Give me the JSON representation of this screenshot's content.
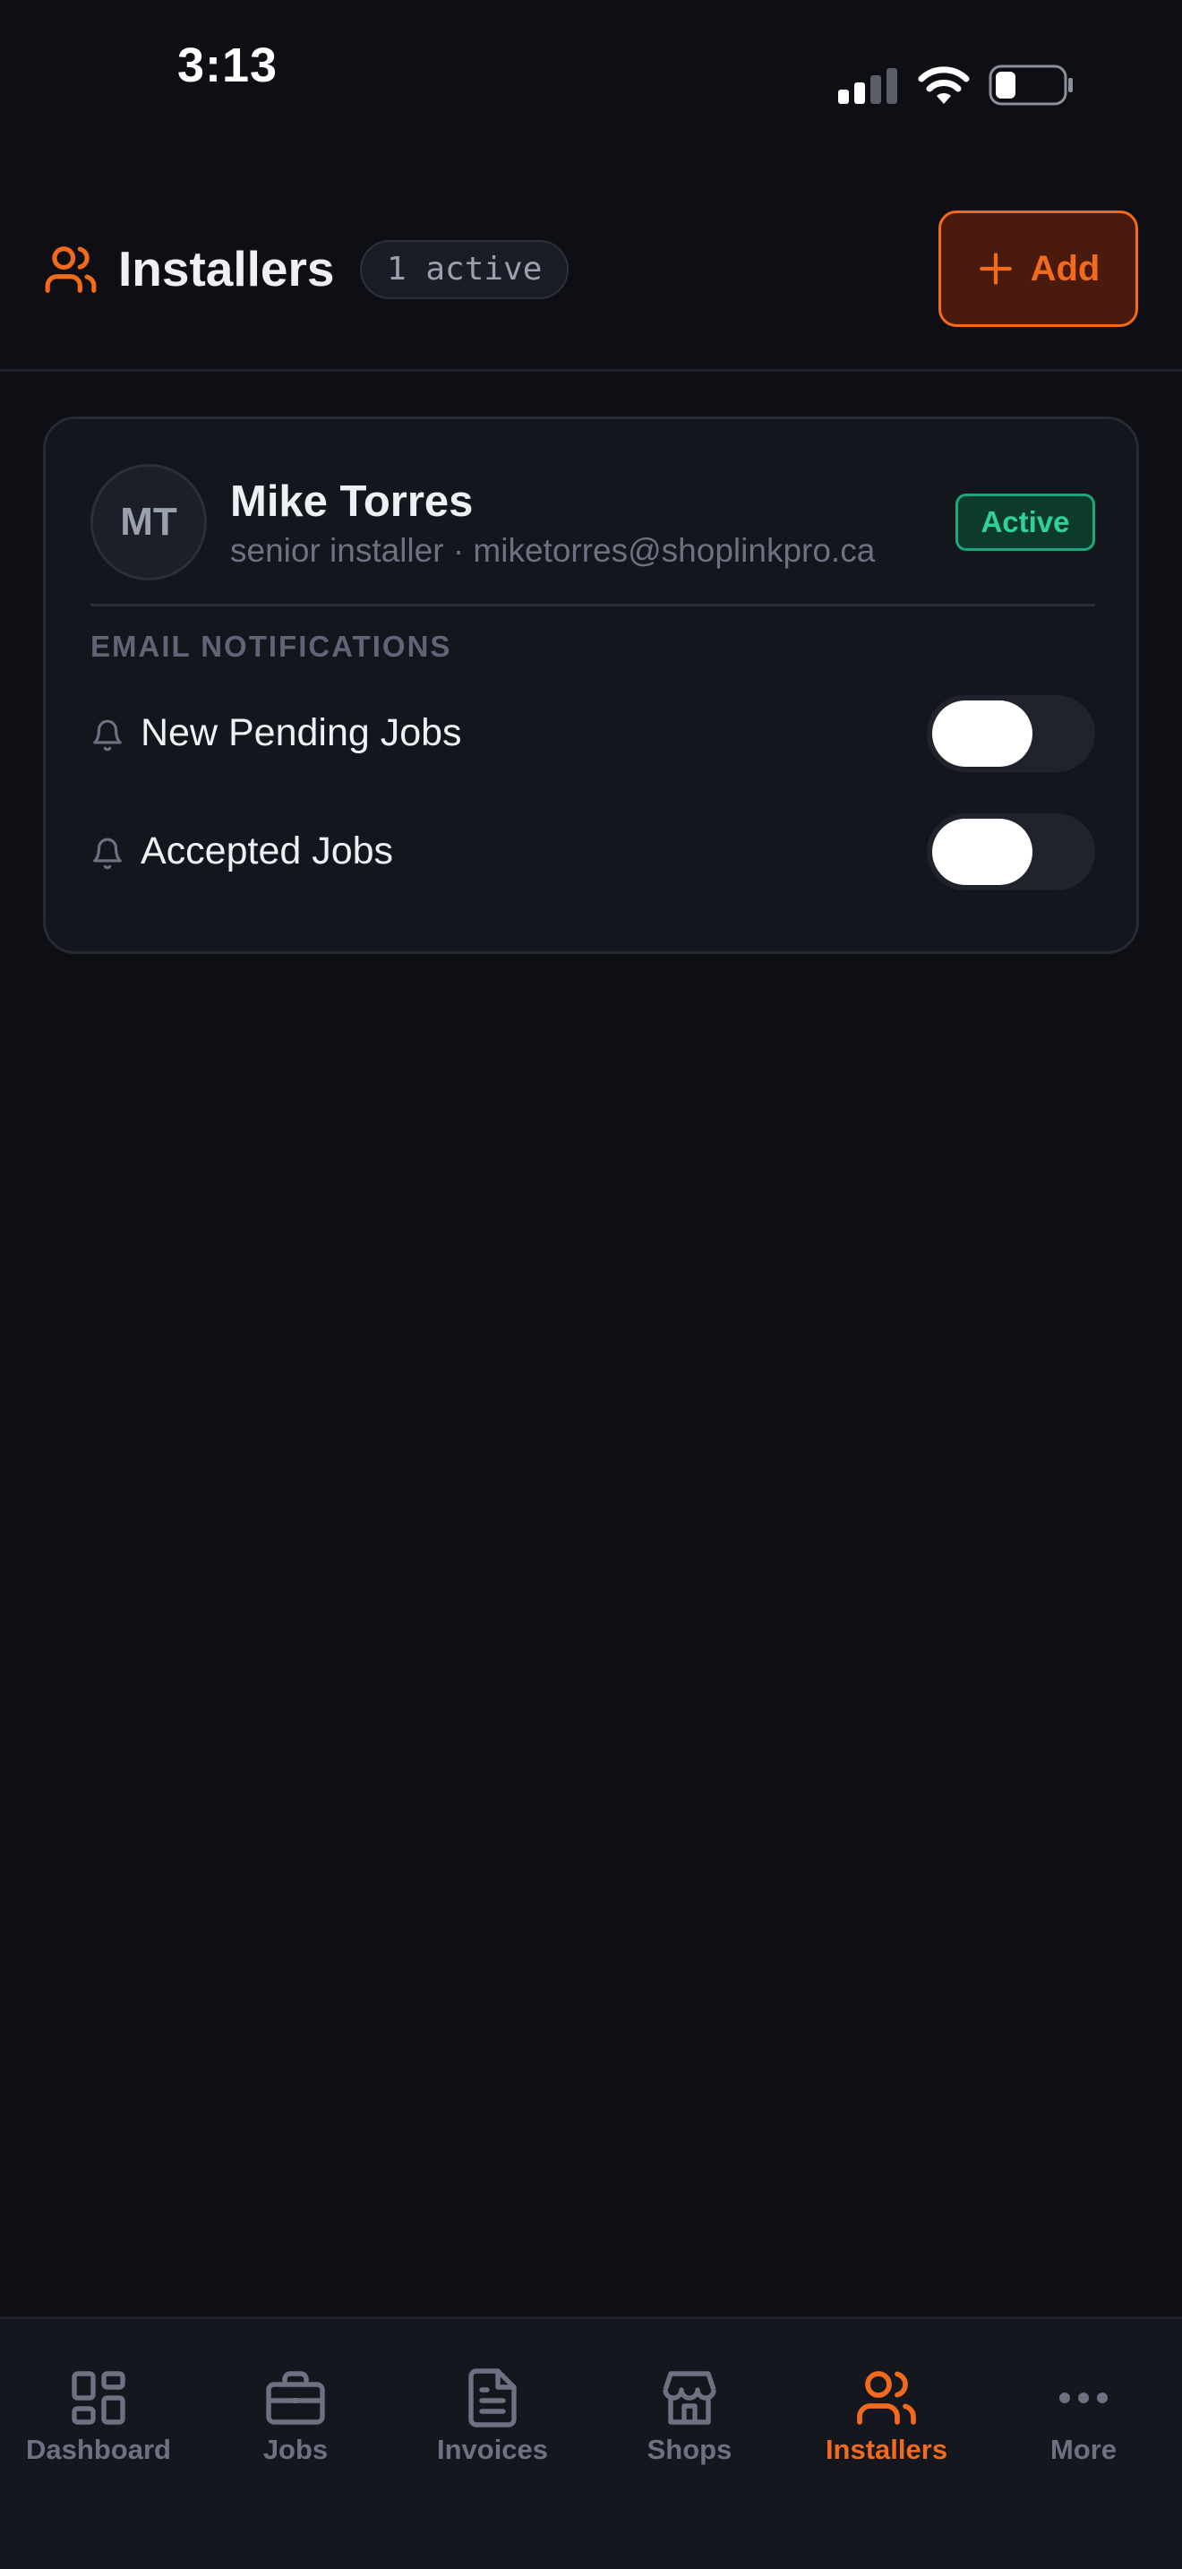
{
  "status_bar": {
    "time": "3:13"
  },
  "header": {
    "title": "Installers",
    "count_badge": "1 active",
    "add_label": "Add"
  },
  "installer": {
    "initials": "MT",
    "name": "Mike Torres",
    "meta": "senior installer · miketorres@shoplinkpro.ca",
    "status": "Active",
    "section_label": "EMAIL NOTIFICATIONS",
    "notifications": [
      {
        "label": "New Pending Jobs",
        "enabled": false
      },
      {
        "label": "Accepted Jobs",
        "enabled": false
      }
    ]
  },
  "tabs": [
    {
      "label": "Dashboard",
      "icon": "grid-icon"
    },
    {
      "label": "Jobs",
      "icon": "briefcase-icon"
    },
    {
      "label": "Invoices",
      "icon": "document-icon"
    },
    {
      "label": "Shops",
      "icon": "store-icon"
    },
    {
      "label": "Installers",
      "icon": "users-icon",
      "active": true
    },
    {
      "label": "More",
      "icon": "more-icon"
    }
  ],
  "colors": {
    "accent": "#f26a1b",
    "background": "#0d0f14",
    "card": "#13161c",
    "success": "#2fd19a"
  }
}
